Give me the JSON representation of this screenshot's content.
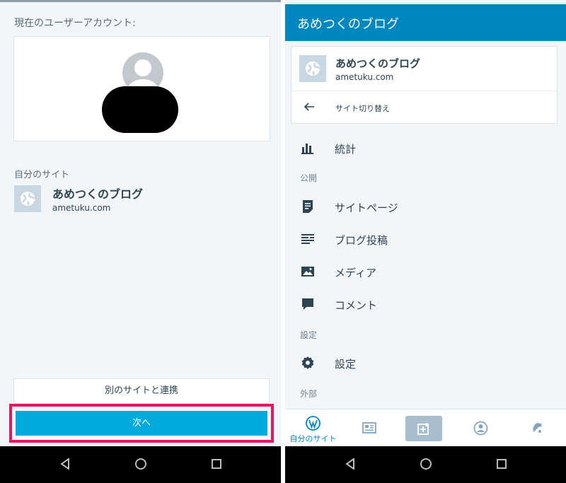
{
  "left": {
    "current_account_label": "現在のユーザーアカウント:",
    "my_sites_label": "自分のサイト",
    "site": {
      "name": "あめつくのブログ",
      "url": "ametuku.com"
    },
    "connect_other_button": "別のサイトと連携",
    "next_button": "次へ",
    "highlight_color": "#e6175f",
    "accent_color": "#00aadc"
  },
  "right": {
    "header_title": "あめつくのブログ",
    "site": {
      "name": "あめつくのブログ",
      "url": "ametuku.com"
    },
    "switch_site_label": "サイト切り替え",
    "menu": {
      "stats": "統計",
      "section_publish": "公開",
      "site_pages": "サイトページ",
      "blog_posts": "ブログ投稿",
      "media": "メディア",
      "comments": "コメント",
      "section_settings": "設定",
      "settings": "設定",
      "section_external": "外部"
    },
    "tabs": {
      "my_site": "自分のサイト",
      "items": [
        "my-site-icon",
        "reader-icon",
        "write-icon",
        "me-icon",
        "notifications-icon"
      ]
    },
    "header_color": "#0087be"
  },
  "system_nav": [
    "back-icon",
    "home-icon",
    "recent-apps-icon"
  ]
}
